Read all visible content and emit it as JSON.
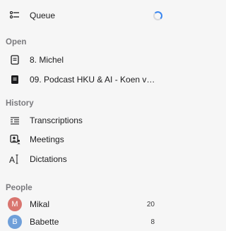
{
  "queue": {
    "label": "Queue",
    "icon": "queue-list-icon",
    "spinner_color": "#3a86f0"
  },
  "open": {
    "title": "Open",
    "items": [
      {
        "label": "8. Michel",
        "icon": "document-outline-icon"
      },
      {
        "label": "09. Podcast HKU & AI - Koen va...",
        "icon": "document-filled-icon"
      }
    ]
  },
  "history": {
    "title": "History",
    "items": [
      {
        "label": "Transcriptions",
        "icon": "transcript-lines-icon"
      },
      {
        "label": "Meetings",
        "icon": "meeting-people-icon"
      },
      {
        "label": "Dictations",
        "icon": "dictation-cursor-icon"
      }
    ]
  },
  "people": {
    "title": "People",
    "items": [
      {
        "name": "Mikal",
        "initial": "M",
        "count": "20",
        "color": "#d9756f"
      },
      {
        "name": "Babette",
        "initial": "B",
        "count": "8",
        "color": "#6f9fd9"
      }
    ]
  }
}
